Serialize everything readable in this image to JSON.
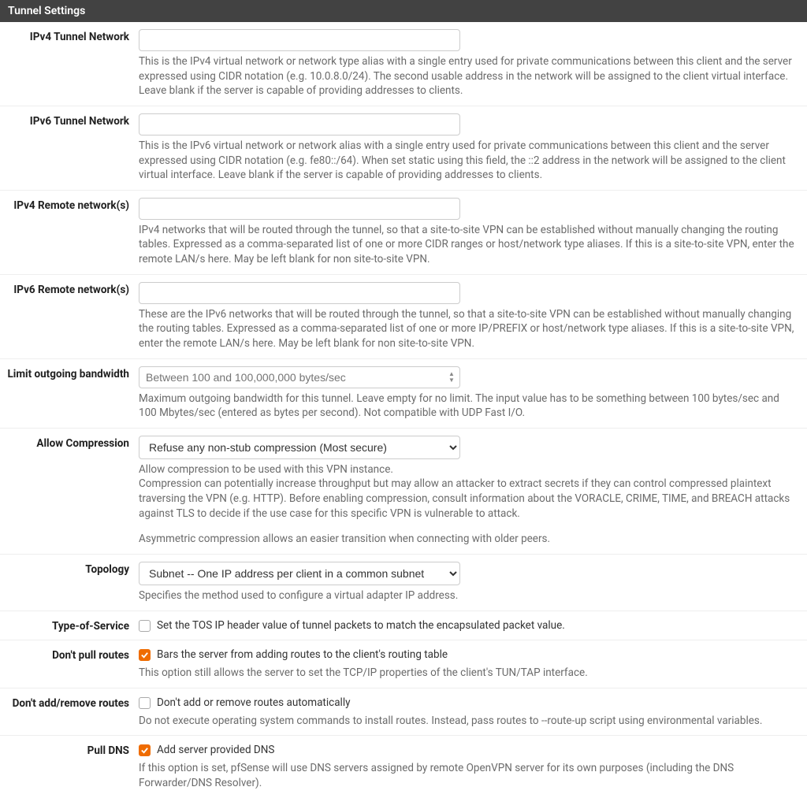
{
  "panel": {
    "title": "Tunnel Settings"
  },
  "fields": {
    "ipv4_tunnel": {
      "label": "IPv4 Tunnel Network",
      "value": "",
      "help": "This is the IPv4 virtual network or network type alias with a single entry used for private communications between this client and the server expressed using CIDR notation (e.g. 10.0.8.0/24). The second usable address in the network will be assigned to the client virtual interface. Leave blank if the server is capable of providing addresses to clients."
    },
    "ipv6_tunnel": {
      "label": "IPv6 Tunnel Network",
      "value": "",
      "help": "This is the IPv6 virtual network or network alias with a single entry used for private communications between this client and the server expressed using CIDR notation (e.g. fe80::/64). When set static using this field, the ::2 address in the network will be assigned to the client virtual interface. Leave blank if the server is capable of providing addresses to clients."
    },
    "ipv4_remote": {
      "label": "IPv4 Remote network(s)",
      "value": "",
      "help": "IPv4 networks that will be routed through the tunnel, so that a site-to-site VPN can be established without manually changing the routing tables. Expressed as a comma-separated list of one or more CIDR ranges or host/network type aliases. If this is a site-to-site VPN, enter the remote LAN/s here. May be left blank for non site-to-site VPN."
    },
    "ipv6_remote": {
      "label": "IPv6 Remote network(s)",
      "value": "",
      "help": "These are the IPv6 networks that will be routed through the tunnel, so that a site-to-site VPN can be established without manually changing the routing tables. Expressed as a comma-separated list of one or more IP/PREFIX or host/network type aliases. If this is a site-to-site VPN, enter the remote LAN/s here. May be left blank for non site-to-site VPN."
    },
    "bandwidth": {
      "label": "Limit outgoing bandwidth",
      "placeholder": "Between 100 and 100,000,000 bytes/sec",
      "help": "Maximum outgoing bandwidth for this tunnel. Leave empty for no limit. The input value has to be something between 100 bytes/sec and 100 Mbytes/sec (entered as bytes per second). Not compatible with UDP Fast I/O."
    },
    "compression": {
      "label": "Allow Compression",
      "selected": "Refuse any non-stub compression (Most secure)",
      "help1": "Allow compression to be used with this VPN instance.",
      "help2": "Compression can potentially increase throughput but may allow an attacker to extract secrets if they can control compressed plaintext traversing the VPN (e.g. HTTP). Before enabling compression, consult information about the VORACLE, CRIME, TIME, and BREACH attacks against TLS to decide if the use case for this specific VPN is vulnerable to attack.",
      "help3": "Asymmetric compression allows an easier transition when connecting with older peers."
    },
    "topology": {
      "label": "Topology",
      "selected": "Subnet -- One IP address per client in a common subnet",
      "help": "Specifies the method used to configure a virtual adapter IP address."
    },
    "tos": {
      "label": "Type-of-Service",
      "checked": false,
      "chk_label": "Set the TOS IP header value of tunnel packets to match the encapsulated packet value."
    },
    "dont_pull": {
      "label": "Don't pull routes",
      "checked": true,
      "chk_label": "Bars the server from adding routes to the client's routing table",
      "help": "This option still allows the server to set the TCP/IP properties of the client's TUN/TAP interface."
    },
    "dont_add": {
      "label": "Don't add/remove routes",
      "checked": false,
      "chk_label": "Don't add or remove routes automatically",
      "help": "Do not execute operating system commands to install routes. Instead, pass routes to --route-up script using environmental variables."
    },
    "pull_dns": {
      "label": "Pull DNS",
      "checked": true,
      "chk_label": "Add server provided DNS",
      "help": "If this option is set, pfSense will use DNS servers assigned by remote OpenVPN server for its own purposes (including the DNS Forwarder/DNS Resolver)."
    }
  }
}
